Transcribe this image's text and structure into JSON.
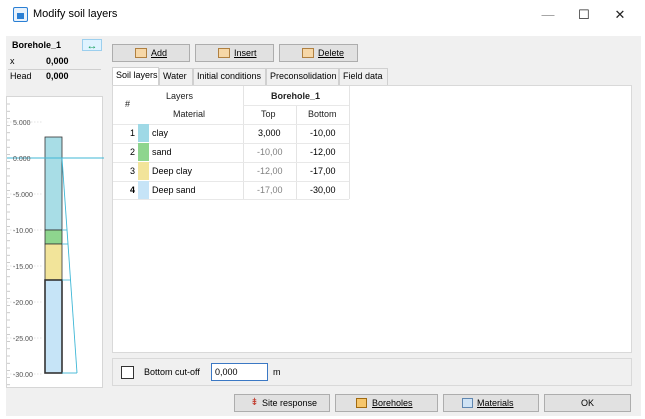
{
  "window": {
    "title": "Modify soil layers"
  },
  "borehole_panel": {
    "name": "Borehole_1",
    "x_label": "x",
    "x_value": "0,000",
    "head_label": "Head",
    "head_value": "0,000",
    "scale_ticks": [
      "5.000",
      "0.000",
      "-5.000",
      "-10.00",
      "-15.00",
      "-20.00",
      "-25.00",
      "-30.00"
    ]
  },
  "toolbar": {
    "add_label": "Add",
    "insert_label": "Insert",
    "delete_label": "Delete"
  },
  "tabs": [
    {
      "label": "Soil layers",
      "active": true
    },
    {
      "label": "Water"
    },
    {
      "label": "Initial conditions"
    },
    {
      "label": "Preconsolidation"
    },
    {
      "label": "Field data"
    }
  ],
  "grid": {
    "col_hash": "#",
    "col_layers": "Layers",
    "col_material": "Material",
    "col_borehole": "Borehole_1",
    "col_top": "Top",
    "col_bottom": "Bottom",
    "rows": [
      {
        "num": "1",
        "material": "clay",
        "top": "3,000",
        "bottom": "-10,00",
        "color": "#9fd9e6"
      },
      {
        "num": "2",
        "material": "sand",
        "top": "-10,00",
        "bottom": "-12,00",
        "color": "#8ed58e"
      },
      {
        "num": "3",
        "material": "Deep clay",
        "top": "-12,00",
        "bottom": "-17,00",
        "color": "#f2e49a"
      },
      {
        "num": "4",
        "material": "Deep sand",
        "top": "-17,00",
        "bottom": "-30,00",
        "color": "#c6e4f7"
      }
    ]
  },
  "cutoff": {
    "label": "Bottom cut-off",
    "value": "0,000",
    "unit": "m"
  },
  "footer": {
    "site_response_label": "Site response",
    "boreholes_label": "Boreholes",
    "materials_label": "Materials",
    "ok_label": "OK"
  }
}
